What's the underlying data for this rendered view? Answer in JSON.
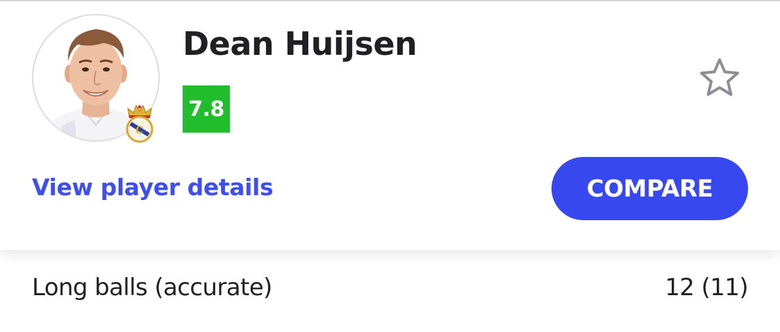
{
  "player": {
    "name": "Dean Huijsen",
    "rating": "7.8",
    "rating_color": "#22bd2c",
    "avatar_icon": "player-photo",
    "club_badge_icon": "real-madrid-crest",
    "favorite_icon": "star-outline-icon"
  },
  "actions": {
    "details_link": "View player details",
    "compare_label": "COMPARE",
    "accent_color": "#3748f0"
  },
  "stats": [
    {
      "label": "Long balls (accurate)",
      "value": "12 (11)"
    }
  ]
}
